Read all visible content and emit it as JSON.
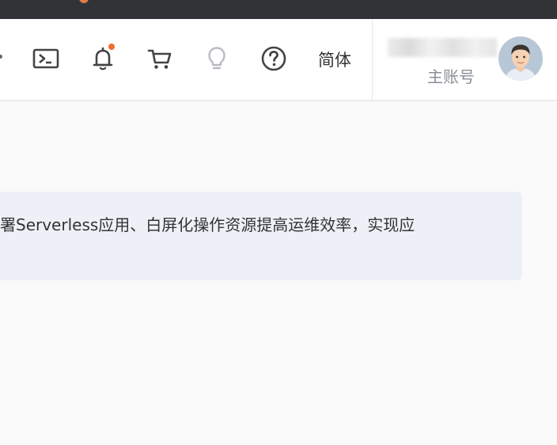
{
  "topbar": {
    "language_label": "简体",
    "icons": [
      "terminal-icon",
      "bell-icon",
      "cart-icon",
      "lightbulb-icon",
      "help-icon"
    ],
    "notification_badge_color": "#f06d2e"
  },
  "account": {
    "name": "",
    "role": "主账号"
  },
  "notice": {
    "text": "署Serverless应用、白屏化操作资源提高运维效率，实现应"
  },
  "colors": {
    "os_bar": "#323337",
    "notice_bg": "#edf1f7",
    "accent_orange": "#f06d2e"
  }
}
